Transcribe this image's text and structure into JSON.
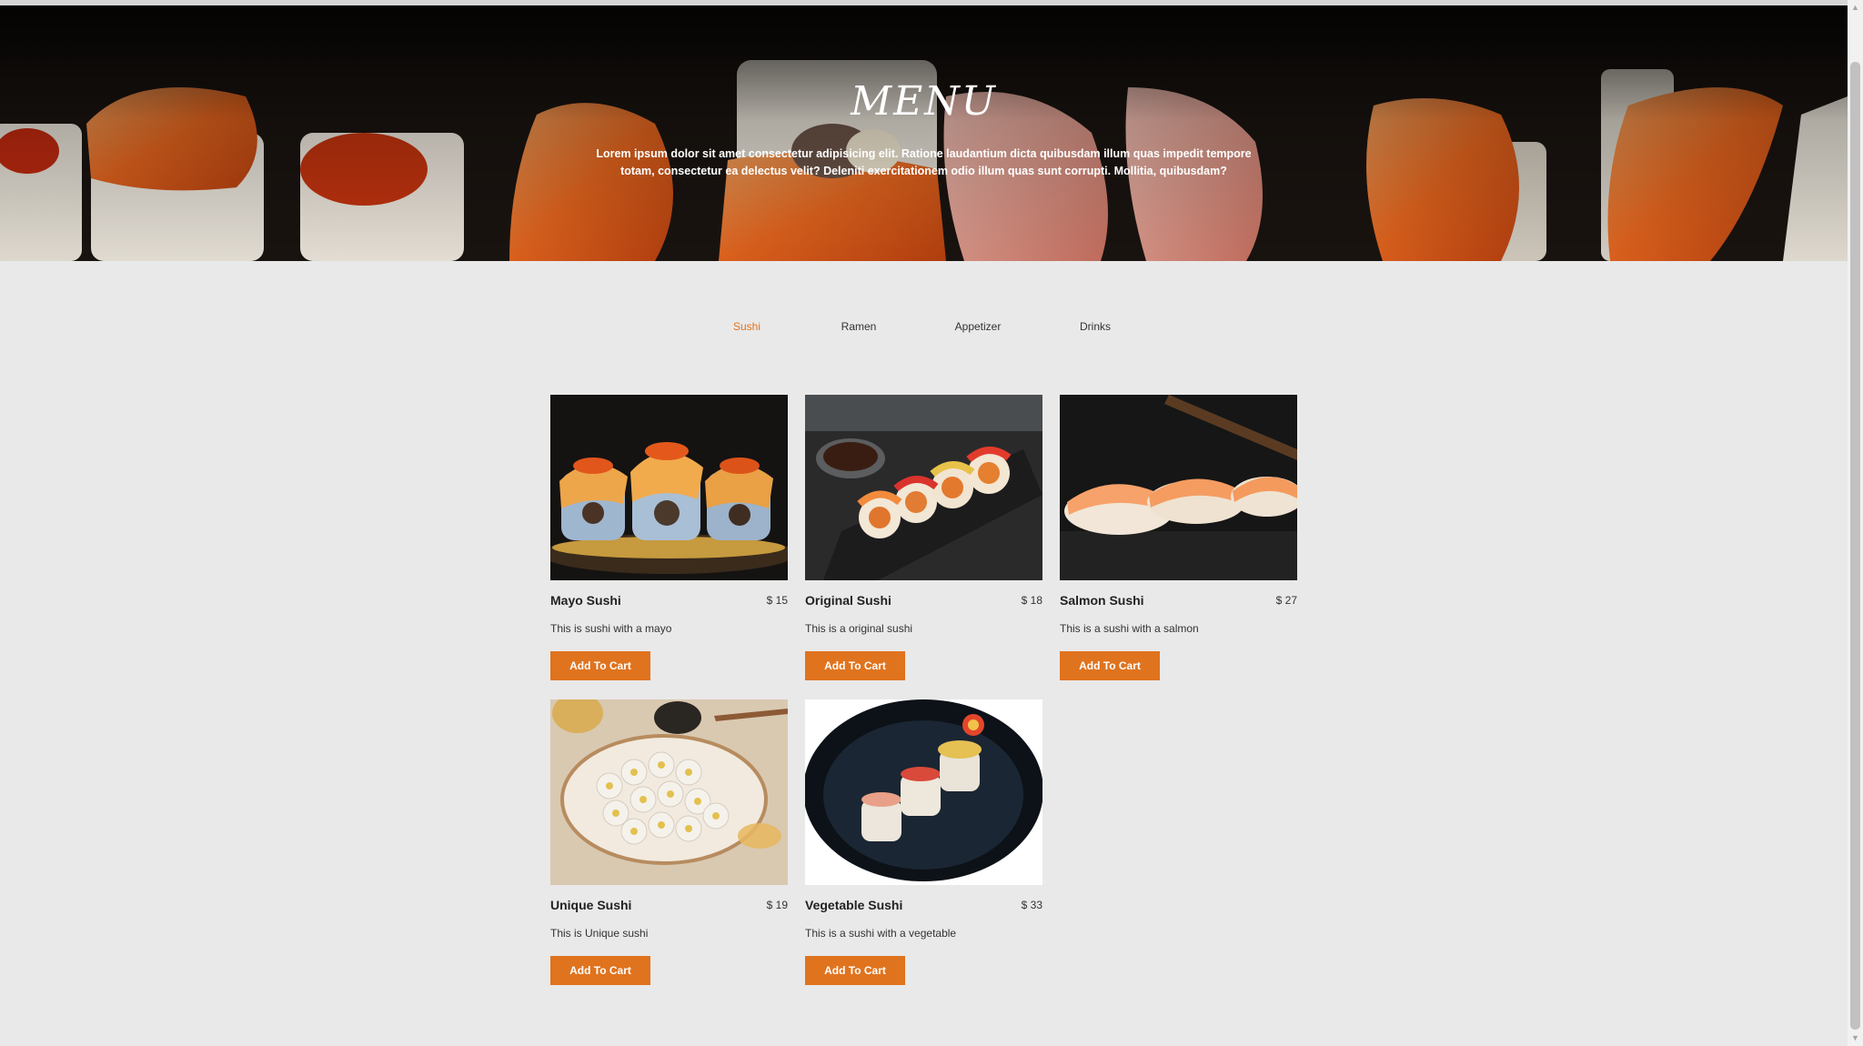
{
  "hero": {
    "title": "MENU",
    "text": "Lorem ipsum dolor sit amet consectetur adipisicing elit. Ratione laudantium dicta quibusdam illum quas impedit tempore totam, consectetur ea delectus velit? Deleniti exercitationem odio illum quas sunt corrupti. Mollitia, quibusdam?"
  },
  "tabs": [
    {
      "label": "Sushi",
      "active": true
    },
    {
      "label": "Ramen",
      "active": false
    },
    {
      "label": "Appetizer",
      "active": false
    },
    {
      "label": "Drinks",
      "active": false
    }
  ],
  "items": [
    {
      "name": "Mayo Sushi",
      "price": "$ 15",
      "desc": "This is sushi with a mayo",
      "button": "Add To Cart"
    },
    {
      "name": "Original Sushi",
      "price": "$ 18",
      "desc": "This is a original sushi",
      "button": "Add To Cart"
    },
    {
      "name": "Salmon Sushi",
      "price": "$ 27",
      "desc": "This is a sushi with a salmon",
      "button": "Add To Cart"
    },
    {
      "name": "Unique Sushi",
      "price": "$ 19",
      "desc": "This is Unique sushi",
      "button": "Add To Cart"
    },
    {
      "name": "Vegetable Sushi",
      "price": "$ 33",
      "desc": "This is a sushi with a vegetable",
      "button": "Add To Cart"
    }
  ],
  "colors": {
    "accent": "#e0731e",
    "background": "#e9e9e9",
    "hero_dark": "#120f0d"
  },
  "icons": {
    "scroll_up": "chevron-up-icon",
    "scroll_down": "chevron-down-icon"
  }
}
